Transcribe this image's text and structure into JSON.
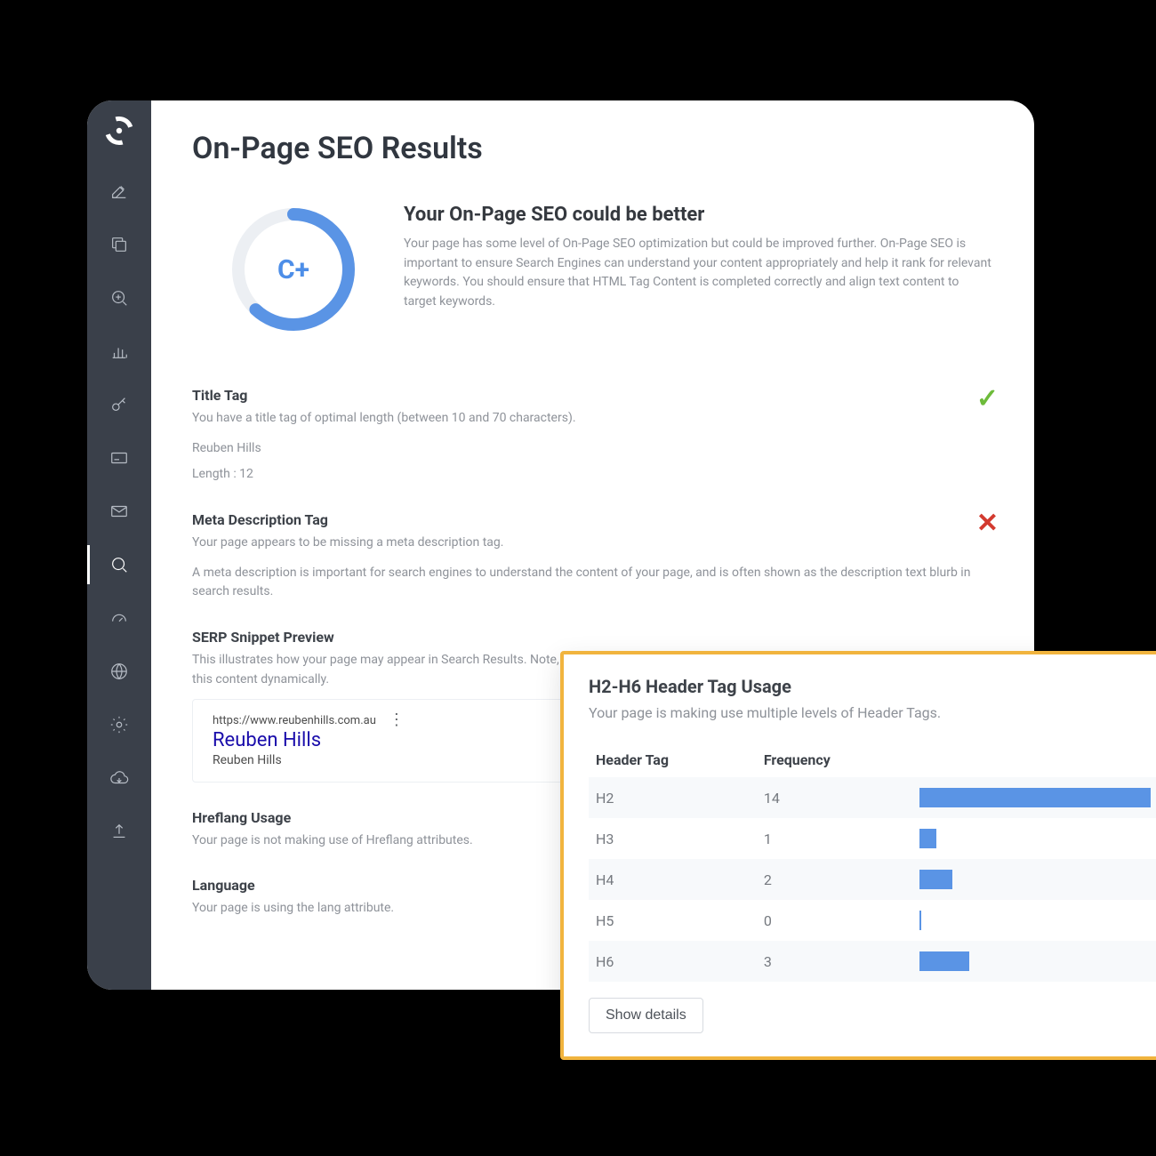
{
  "page": {
    "title": "On-Page SEO Results",
    "grade": "C+",
    "grade_percent": 62,
    "summary_heading": "Your On-Page SEO could be better",
    "summary_body": "Your page has some level of On-Page SEO optimization but could be improved further. On-Page SEO is important to ensure Search Engines can understand your content appropriately and help it rank for relevant keywords. You should ensure that HTML Tag Content is completed correctly and align text content to target keywords."
  },
  "sidebar": {
    "items": [
      {
        "name": "edit"
      },
      {
        "name": "copy"
      },
      {
        "name": "zoom-in"
      },
      {
        "name": "bar-chart"
      },
      {
        "name": "key"
      },
      {
        "name": "card"
      },
      {
        "name": "mail"
      },
      {
        "name": "search"
      },
      {
        "name": "gauge"
      },
      {
        "name": "globe"
      },
      {
        "name": "settings"
      },
      {
        "name": "cloud-download"
      },
      {
        "name": "upload"
      }
    ],
    "active_index": 7
  },
  "items": {
    "title_tag": {
      "title": "Title Tag",
      "desc": "You have a title tag of optimal length (between 10 and 70 characters).",
      "value": "Reuben Hills",
      "length_label": "Length : 12",
      "status": "ok"
    },
    "meta_desc": {
      "title": "Meta Description Tag",
      "desc1": "Your page appears to be missing a meta description tag.",
      "desc2": "A meta description is important for search engines to understand the content of your page, and is often shown as the description text blurb in search results.",
      "status": "bad"
    },
    "serp": {
      "title": "SERP Snippet Preview",
      "desc": "This illustrates how your page may appear in Search Results. Note, this is intended as a guide and Search Engines are more frequently generating this content dynamically.",
      "url": "https://www.reubenhills.com.au",
      "result_title": "Reuben Hills",
      "result_sub": "Reuben Hills"
    },
    "hreflang": {
      "title": "Hreflang Usage",
      "desc": "Your page is not making use of Hreflang attributes."
    },
    "language": {
      "title": "Language",
      "desc": "Your page is using the lang attribute."
    }
  },
  "overlay": {
    "title": "H2-H6 Header Tag Usage",
    "sub": "Your page is making use multiple levels of Header Tags.",
    "col1": "Header Tag",
    "col2": "Frequency",
    "rows": [
      {
        "tag": "H2",
        "freq": 14
      },
      {
        "tag": "H3",
        "freq": 1
      },
      {
        "tag": "H4",
        "freq": 2
      },
      {
        "tag": "H5",
        "freq": 0
      },
      {
        "tag": "H6",
        "freq": 3
      }
    ],
    "button": "Show details"
  },
  "chart_data": {
    "type": "bar",
    "title": "H2-H6 Header Tag Usage",
    "xlabel": "Header Tag",
    "ylabel": "Frequency",
    "categories": [
      "H2",
      "H3",
      "H4",
      "H5",
      "H6"
    ],
    "values": [
      14,
      1,
      2,
      0,
      3
    ],
    "ylim": [
      0,
      14
    ]
  },
  "colors": {
    "accent": "#5a94e5",
    "ok": "#6dbb3a",
    "bad": "#d33a2f",
    "panel_border": "#f1b43e"
  }
}
